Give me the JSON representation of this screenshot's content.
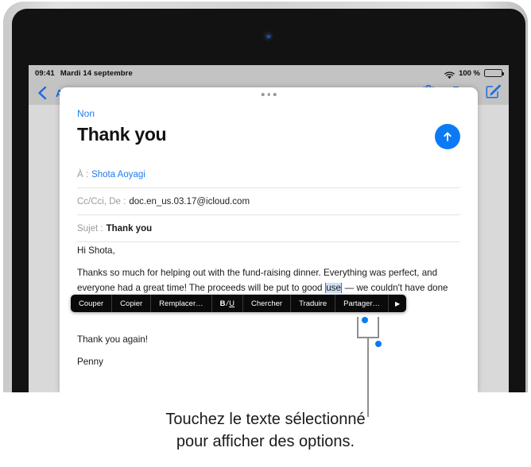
{
  "device": {
    "name": "ipad-frame"
  },
  "status_bar": {
    "time": "09:41",
    "date": "Mardi 14 septembre",
    "battery_percent": "100 %",
    "wifi_icon": "wifi-icon",
    "battery_icon": "battery-icon"
  },
  "mail_toolbar": {
    "back_icon": "back-chevron-icon",
    "hidden_title": "Accueil",
    "trash_icon": "trash-icon",
    "folder_icon": "folder-icon",
    "compose_icon": "compose-icon"
  },
  "compose_sheet": {
    "grabber": "drag-handle",
    "cancel_label": "Non",
    "title": "Thank you",
    "send_icon": "send-arrow-up-icon",
    "fields": [
      {
        "label": "À :",
        "value": "Shota Aoyagi",
        "style": "link"
      },
      {
        "label": "Cc/Cci, De :",
        "value": "doc.en_us.03.17@icloud.com",
        "style": "plain"
      },
      {
        "label": "Sujet :",
        "value": "Thank you",
        "style": "bold"
      }
    ],
    "body": {
      "greeting": "Hi Shota,",
      "para1_before": "Thanks so much for helping out with the fund-raising dinner. Everything was perfect, and everyone had a great time! The proceeds will be put to good ",
      "selected_word": "use",
      "para1_after": " — we couldn't have done it without you and everyone on the team.",
      "para2": "Thank you again!",
      "signoff": "Penny"
    }
  },
  "context_menu": {
    "items": [
      {
        "label": "Couper",
        "name": "menu-item-cut"
      },
      {
        "label": "Copier",
        "name": "menu-item-copy"
      },
      {
        "label": "Remplacer…",
        "name": "menu-item-replace"
      },
      {
        "label": "B/U",
        "name": "menu-item-format"
      },
      {
        "label": "Chercher",
        "name": "menu-item-look-up"
      },
      {
        "label": "Traduire",
        "name": "menu-item-translate"
      },
      {
        "label": "Partager…",
        "name": "menu-item-share"
      }
    ],
    "more_arrow": "▶"
  },
  "caption": {
    "line1": "Touchez le texte sélectionné",
    "line2": "pour afficher des options."
  },
  "colors": {
    "accent_blue": "#0b7bf5",
    "link_blue": "#1f7cf2",
    "menu_bg": "#0a0a0a",
    "selection_highlight": "#cfe0f7",
    "callout_gray": "#8e8e8e"
  }
}
